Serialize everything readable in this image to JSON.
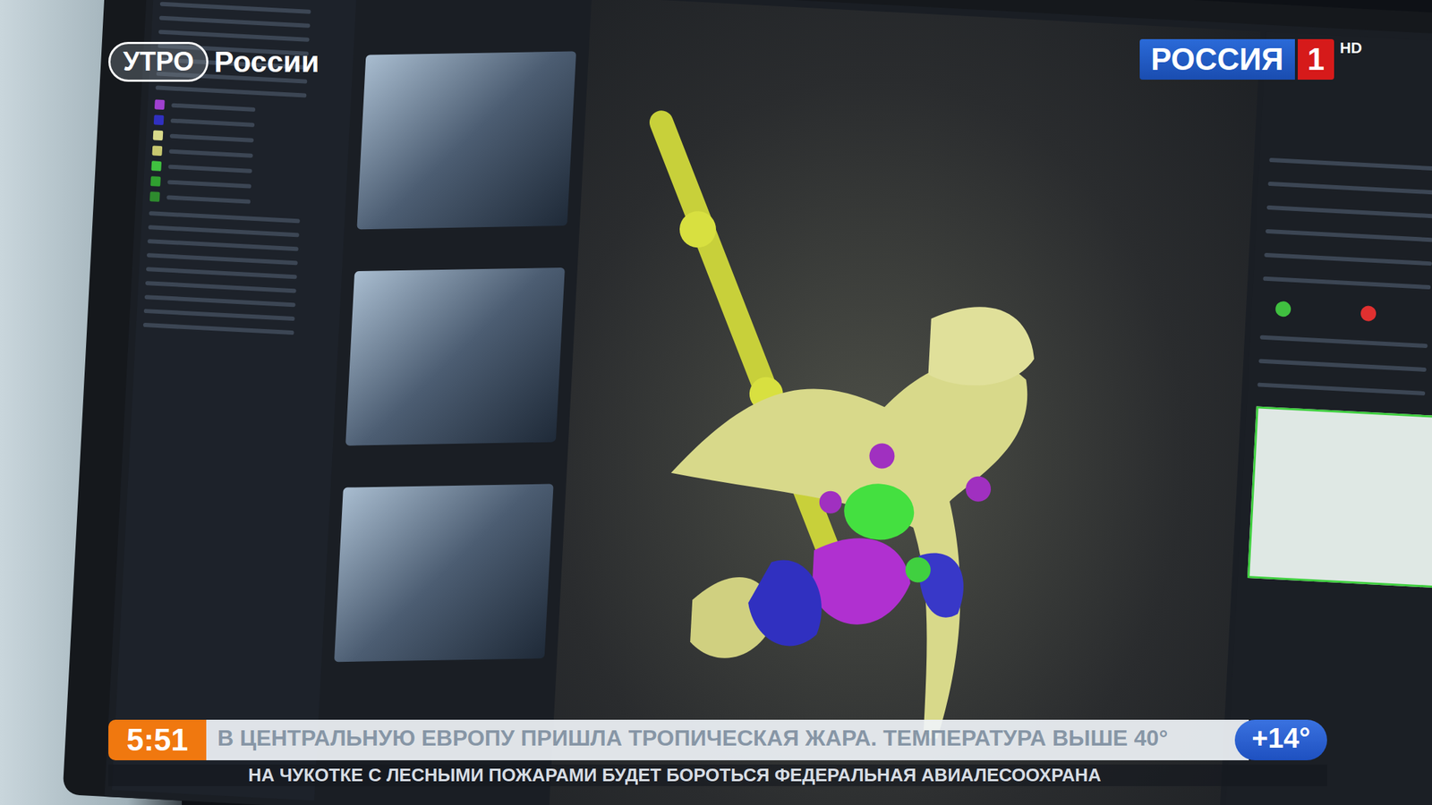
{
  "logo": {
    "primary": "УТРО",
    "secondary": "России"
  },
  "channel": {
    "name": "РОССИЯ",
    "number": "1",
    "badge": "HD"
  },
  "ticker": {
    "time": "5:51",
    "headline": "В ЦЕНТРАЛЬНУЮ ЕВРОПУ ПРИШЛА ТРОПИЧЕСКАЯ ЖАРА. ТЕМПЕРАТУРА ВЫШЕ 40°",
    "next": "НА ЧУКОТКЕ С ЛЕСНЫМИ ПОЖАРАМИ БУДЕТ БОРОТЬСЯ ФЕДЕРАЛЬНАЯ АВИАЛЕСООХРАНА",
    "temperature": "+14°"
  }
}
